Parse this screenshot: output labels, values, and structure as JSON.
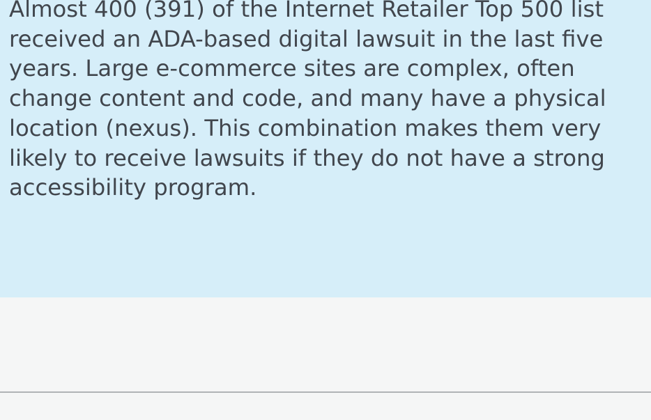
{
  "callout": {
    "text": "Almost 400 (391) of the Internet Retailer Top 500 list\nreceived an ADA-based digital lawsuit in the last five\nyears. Large e-commerce sites are complex, often\nchange content and code, and many have a physical\nlocation (nexus). This combination makes them very\nlikely to receive lawsuits if they do not have a strong\naccessibility program."
  },
  "colors": {
    "callout_background": "#d6eef9",
    "text": "#41464d",
    "page_background": "#f5f6f6",
    "divider": "#b0b3b6"
  }
}
